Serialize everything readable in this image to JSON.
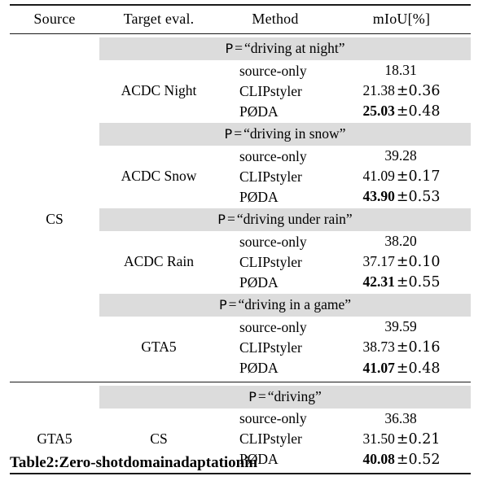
{
  "table": {
    "columns": [
      "Source",
      "Target eval.",
      "Method",
      "mIoU[%]"
    ],
    "sections": [
      {
        "source": "CS",
        "blocks": [
          {
            "prompt_symbol": "P",
            "prompt_equals": "=",
            "prompt_text": "“driving at night”",
            "target": "ACDC Night",
            "rows": [
              {
                "method": "source-only",
                "value": "18.31",
                "std": "",
                "bold": false
              },
              {
                "method": "CLIPstyler",
                "value": "21.38",
                "std": "±0.36",
                "bold": false
              },
              {
                "method": "PØDA",
                "value": "25.03",
                "std": "±0.48",
                "bold": true
              }
            ]
          },
          {
            "prompt_symbol": "P",
            "prompt_equals": "=",
            "prompt_text": "“driving in snow”",
            "target": "ACDC Snow",
            "rows": [
              {
                "method": "source-only",
                "value": "39.28",
                "std": "",
                "bold": false
              },
              {
                "method": "CLIPstyler",
                "value": "41.09",
                "std": "±0.17",
                "bold": false
              },
              {
                "method": "PØDA",
                "value": "43.90",
                "std": "±0.53",
                "bold": true
              }
            ]
          },
          {
            "prompt_symbol": "P",
            "prompt_equals": "=",
            "prompt_text": "“driving under rain”",
            "target": "ACDC Rain",
            "rows": [
              {
                "method": "source-only",
                "value": "38.20",
                "std": "",
                "bold": false
              },
              {
                "method": "CLIPstyler",
                "value": "37.17",
                "std": "±0.10",
                "bold": false
              },
              {
                "method": "PØDA",
                "value": "42.31",
                "std": "±0.55",
                "bold": true
              }
            ]
          },
          {
            "prompt_symbol": "P",
            "prompt_equals": "=",
            "prompt_text": "“driving in a game”",
            "target": "GTA5",
            "rows": [
              {
                "method": "source-only",
                "value": "39.59",
                "std": "",
                "bold": false
              },
              {
                "method": "CLIPstyler",
                "value": "38.73",
                "std": "±0.16",
                "bold": false
              },
              {
                "method": "PØDA",
                "value": "41.07",
                "std": "±0.48",
                "bold": true
              }
            ]
          }
        ]
      },
      {
        "source": "GTA5",
        "blocks": [
          {
            "prompt_symbol": "P",
            "prompt_equals": "=",
            "prompt_text": "“driving”",
            "target": "CS",
            "rows": [
              {
                "method": "source-only",
                "value": "36.38",
                "std": "",
                "bold": false
              },
              {
                "method": "CLIPstyler",
                "value": "31.50",
                "std": "±0.21",
                "bold": false
              },
              {
                "method": "PØDA",
                "value": "40.08",
                "std": "±0.52",
                "bold": true
              }
            ]
          }
        ]
      }
    ]
  },
  "caption": {
    "label": "Table",
    "number": "2:",
    "w1": "Zero-shot",
    "w2": "domain",
    "w3": "adaptation",
    "w4": "in"
  },
  "style": {
    "shade_color": "#dcdcdc",
    "rule_color": "#1a1a1a",
    "text_color": "#000000"
  }
}
